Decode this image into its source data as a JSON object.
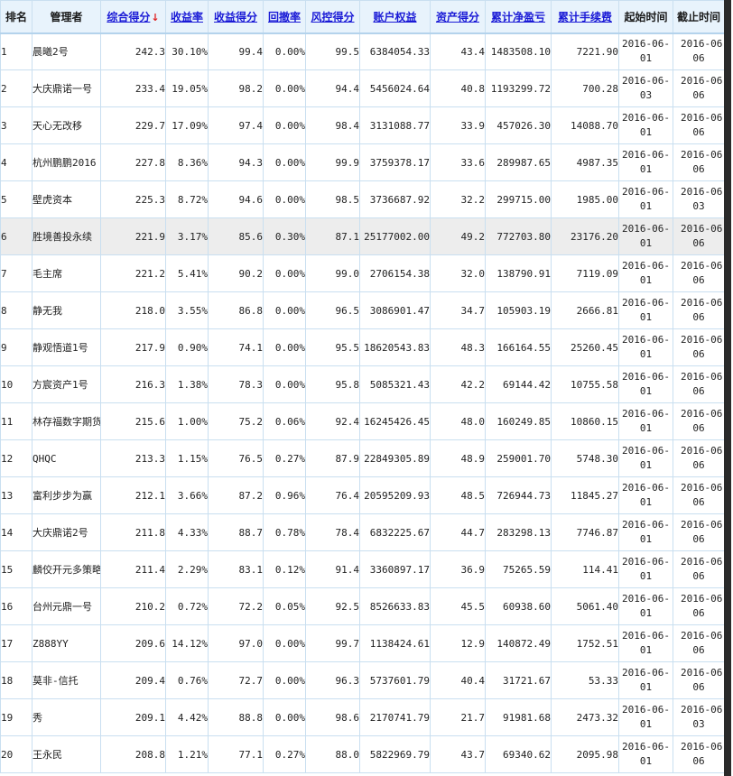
{
  "table": {
    "headers": {
      "rank": "排名",
      "manager": "管理者",
      "total_score": "综合得分",
      "return_rate": "收益率",
      "return_score": "收益得分",
      "drawdown": "回撤率",
      "risk_score": "风控得分",
      "equity": "账户权益",
      "asset_score": "资产得分",
      "cum_pnl": "累计净盈亏",
      "cum_fee": "累计手续费",
      "start_time": "起始时间",
      "end_time": "截止时间"
    },
    "sort_arrow": "↓",
    "rows": [
      {
        "rank": "1",
        "manager": "晨曦2号",
        "total": "242.3",
        "rate": "30.10%",
        "rscore": "99.4",
        "dd": "0.00%",
        "risk": "99.5",
        "equity": "6384054.33",
        "asset": "43.4",
        "pnl": "1483508.10",
        "fee": "7221.90",
        "start1": "2016-06-",
        "start2": "01",
        "end1": "2016-06-",
        "end2": "06"
      },
      {
        "rank": "2",
        "manager": "大庆鼎诺一号",
        "total": "233.4",
        "rate": "19.05%",
        "rscore": "98.2",
        "dd": "0.00%",
        "risk": "94.4",
        "equity": "5456024.64",
        "asset": "40.8",
        "pnl": "1193299.72",
        "fee": "700.28",
        "start1": "2016-06-",
        "start2": "03",
        "end1": "2016-06-",
        "end2": "06"
      },
      {
        "rank": "3",
        "manager": "天心无改移",
        "total": "229.7",
        "rate": "17.09%",
        "rscore": "97.4",
        "dd": "0.00%",
        "risk": "98.4",
        "equity": "3131088.77",
        "asset": "33.9",
        "pnl": "457026.30",
        "fee": "14088.70",
        "start1": "2016-06-",
        "start2": "01",
        "end1": "2016-06-",
        "end2": "06"
      },
      {
        "rank": "4",
        "manager": "杭州鹏鹏2016",
        "total": "227.8",
        "rate": "8.36%",
        "rscore": "94.3",
        "dd": "0.00%",
        "risk": "99.9",
        "equity": "3759378.17",
        "asset": "33.6",
        "pnl": "289987.65",
        "fee": "4987.35",
        "start1": "2016-06-",
        "start2": "01",
        "end1": "2016-06-",
        "end2": "06"
      },
      {
        "rank": "5",
        "manager": "壁虎资本",
        "total": "225.3",
        "rate": "8.72%",
        "rscore": "94.6",
        "dd": "0.00%",
        "risk": "98.5",
        "equity": "3736687.92",
        "asset": "32.2",
        "pnl": "299715.00",
        "fee": "1985.00",
        "start1": "2016-06-",
        "start2": "01",
        "end1": "2016-06-",
        "end2": "03"
      },
      {
        "rank": "6",
        "manager": "胜境善投永续",
        "total": "221.9",
        "rate": "3.17%",
        "rscore": "85.6",
        "dd": "0.30%",
        "risk": "87.1",
        "equity": "25177002.00",
        "asset": "49.2",
        "pnl": "772703.80",
        "fee": "23176.20",
        "start1": "2016-06-",
        "start2": "01",
        "end1": "2016-06-",
        "end2": "06"
      },
      {
        "rank": "7",
        "manager": "毛主席",
        "total": "221.2",
        "rate": "5.41%",
        "rscore": "90.2",
        "dd": "0.00%",
        "risk": "99.0",
        "equity": "2706154.38",
        "asset": "32.0",
        "pnl": "138790.91",
        "fee": "7119.09",
        "start1": "2016-06-",
        "start2": "01",
        "end1": "2016-06-",
        "end2": "06"
      },
      {
        "rank": "8",
        "manager": "静无我",
        "total": "218.0",
        "rate": "3.55%",
        "rscore": "86.8",
        "dd": "0.00%",
        "risk": "96.5",
        "equity": "3086901.47",
        "asset": "34.7",
        "pnl": "105903.19",
        "fee": "2666.81",
        "start1": "2016-06-",
        "start2": "01",
        "end1": "2016-06-",
        "end2": "06"
      },
      {
        "rank": "9",
        "manager": "静观悟道1号",
        "total": "217.9",
        "rate": "0.90%",
        "rscore": "74.1",
        "dd": "0.00%",
        "risk": "95.5",
        "equity": "18620543.83",
        "asset": "48.3",
        "pnl": "166164.55",
        "fee": "25260.45",
        "start1": "2016-06-",
        "start2": "01",
        "end1": "2016-06-",
        "end2": "06"
      },
      {
        "rank": "10",
        "manager": "方宸资产1号",
        "total": "216.3",
        "rate": "1.38%",
        "rscore": "78.3",
        "dd": "0.00%",
        "risk": "95.8",
        "equity": "5085321.43",
        "asset": "42.2",
        "pnl": "69144.42",
        "fee": "10755.58",
        "start1": "2016-06-",
        "start2": "01",
        "end1": "2016-06-",
        "end2": "06"
      },
      {
        "rank": "11",
        "manager": "林存福数字期货",
        "total": "215.6",
        "rate": "1.00%",
        "rscore": "75.2",
        "dd": "0.06%",
        "risk": "92.4",
        "equity": "16245426.45",
        "asset": "48.0",
        "pnl": "160249.85",
        "fee": "10860.15",
        "start1": "2016-06-",
        "start2": "01",
        "end1": "2016-06-",
        "end2": "06"
      },
      {
        "rank": "12",
        "manager": "QHQC",
        "total": "213.3",
        "rate": "1.15%",
        "rscore": "76.5",
        "dd": "0.27%",
        "risk": "87.9",
        "equity": "22849305.89",
        "asset": "48.9",
        "pnl": "259001.70",
        "fee": "5748.30",
        "start1": "2016-06-",
        "start2": "01",
        "end1": "2016-06-",
        "end2": "06"
      },
      {
        "rank": "13",
        "manager": "富利步步为赢",
        "total": "212.1",
        "rate": "3.66%",
        "rscore": "87.2",
        "dd": "0.96%",
        "risk": "76.4",
        "equity": "20595209.93",
        "asset": "48.5",
        "pnl": "726944.73",
        "fee": "11845.27",
        "start1": "2016-06-",
        "start2": "01",
        "end1": "2016-06-",
        "end2": "06"
      },
      {
        "rank": "14",
        "manager": "大庆鼎诺2号",
        "total": "211.8",
        "rate": "4.33%",
        "rscore": "88.7",
        "dd": "0.78%",
        "risk": "78.4",
        "equity": "6832225.67",
        "asset": "44.7",
        "pnl": "283298.13",
        "fee": "7746.87",
        "start1": "2016-06-",
        "start2": "01",
        "end1": "2016-06-",
        "end2": "06"
      },
      {
        "rank": "15",
        "manager": "麟佼开元多策略",
        "total": "211.4",
        "rate": "2.29%",
        "rscore": "83.1",
        "dd": "0.12%",
        "risk": "91.4",
        "equity": "3360897.17",
        "asset": "36.9",
        "pnl": "75265.59",
        "fee": "114.41",
        "start1": "2016-06-",
        "start2": "01",
        "end1": "2016-06-",
        "end2": "06"
      },
      {
        "rank": "16",
        "manager": "台州元鼎一号",
        "total": "210.2",
        "rate": "0.72%",
        "rscore": "72.2",
        "dd": "0.05%",
        "risk": "92.5",
        "equity": "8526633.83",
        "asset": "45.5",
        "pnl": "60938.60",
        "fee": "5061.40",
        "start1": "2016-06-",
        "start2": "01",
        "end1": "2016-06-",
        "end2": "06"
      },
      {
        "rank": "17",
        "manager": "Z888YY",
        "total": "209.6",
        "rate": "14.12%",
        "rscore": "97.0",
        "dd": "0.00%",
        "risk": "99.7",
        "equity": "1138424.61",
        "asset": "12.9",
        "pnl": "140872.49",
        "fee": "1752.51",
        "start1": "2016-06-",
        "start2": "01",
        "end1": "2016-06-",
        "end2": "06"
      },
      {
        "rank": "18",
        "manager": "莫非-信托",
        "total": "209.4",
        "rate": "0.76%",
        "rscore": "72.7",
        "dd": "0.00%",
        "risk": "96.3",
        "equity": "5737601.79",
        "asset": "40.4",
        "pnl": "31721.67",
        "fee": "53.33",
        "start1": "2016-06-",
        "start2": "01",
        "end1": "2016-06-",
        "end2": "06"
      },
      {
        "rank": "19",
        "manager": "秀",
        "total": "209.1",
        "rate": "4.42%",
        "rscore": "88.8",
        "dd": "0.00%",
        "risk": "98.6",
        "equity": "2170741.79",
        "asset": "21.7",
        "pnl": "91981.68",
        "fee": "2473.32",
        "start1": "2016-06-",
        "start2": "01",
        "end1": "2016-06-",
        "end2": "03"
      },
      {
        "rank": "20",
        "manager": "王永民",
        "total": "208.8",
        "rate": "1.21%",
        "rscore": "77.1",
        "dd": "0.27%",
        "risk": "88.0",
        "equity": "5822969.79",
        "asset": "43.7",
        "pnl": "69340.62",
        "fee": "2095.98",
        "start1": "2016-06-",
        "start2": "01",
        "end1": "2016-06-",
        "end2": "06"
      }
    ]
  },
  "colors": {
    "header_bg": "#e8f3fc",
    "border": "#c9dff0",
    "link": "#1a1ad6",
    "pnl": "#e01818",
    "highlight_row": "#ededed"
  }
}
